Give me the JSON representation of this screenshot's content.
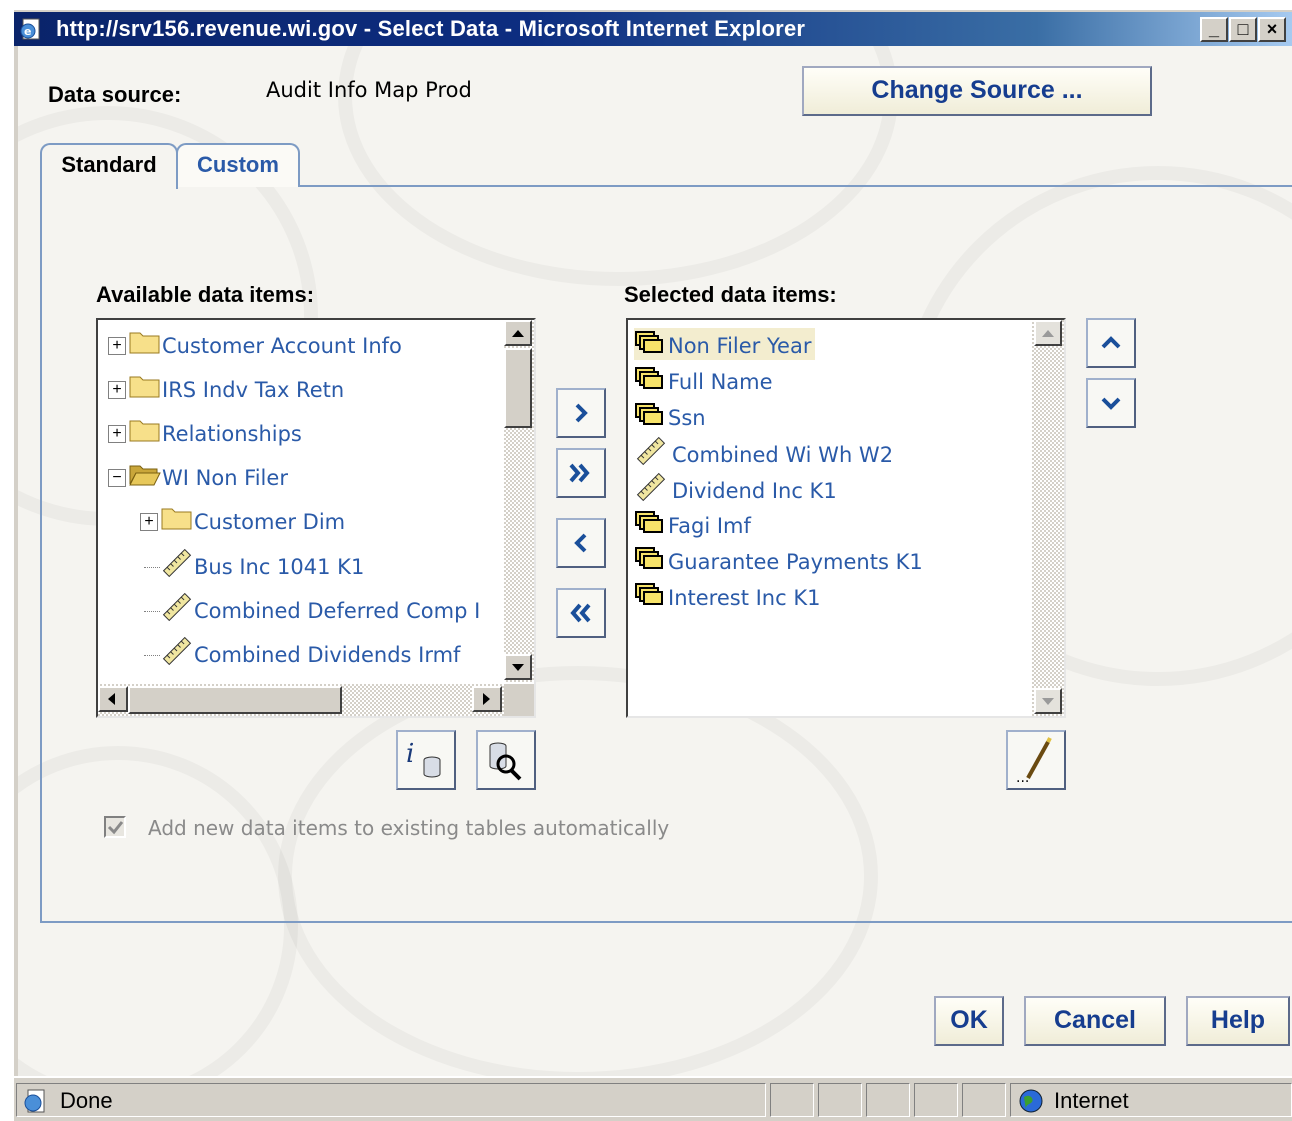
{
  "window": {
    "title": "http://srv156.revenue.wi.gov - Select Data - Microsoft Internet Explorer",
    "minimize": "_",
    "maximize": "□",
    "close": "×"
  },
  "header": {
    "data_source_label": "Data source:",
    "data_source_value": "Audit Info Map Prod",
    "change_source_button": "Change Source ..."
  },
  "tabs": [
    {
      "label": "Standard",
      "active": true
    },
    {
      "label": "Custom",
      "active": false
    }
  ],
  "available": {
    "title": "Available data items:",
    "items": [
      {
        "label": "Customer Account Info",
        "icon": "folder-icon",
        "expander": "+",
        "level": 0
      },
      {
        "label": "IRS Indv Tax Retn",
        "icon": "folder-icon",
        "expander": "+",
        "level": 0
      },
      {
        "label": "Relationships",
        "icon": "folder-icon",
        "expander": "+",
        "level": 0
      },
      {
        "label": "WI Non Filer",
        "icon": "folder-open-icon",
        "expander": "−",
        "level": 0
      },
      {
        "label": "Customer Dim",
        "icon": "folder-icon",
        "expander": "+",
        "level": 1
      },
      {
        "label": "Bus Inc 1041 K1",
        "icon": "measure-icon",
        "expander": "",
        "level": 1
      },
      {
        "label": "Combined Deferred Comp I",
        "icon": "measure-icon",
        "expander": "",
        "level": 1
      },
      {
        "label": "Combined Dividends Irmf",
        "icon": "measure-icon",
        "expander": "",
        "level": 1
      }
    ]
  },
  "selected": {
    "title": "Selected data items:",
    "items": [
      {
        "label": "Non Filer Year",
        "icon": "category-icon",
        "selected": true
      },
      {
        "label": "Full Name",
        "icon": "category-icon",
        "selected": false
      },
      {
        "label": "Ssn",
        "icon": "category-icon",
        "selected": false
      },
      {
        "label": "Combined Wi Wh W2",
        "icon": "measure-icon",
        "selected": false
      },
      {
        "label": "Dividend Inc K1",
        "icon": "measure-icon",
        "selected": false
      },
      {
        "label": "Fagi Imf",
        "icon": "category-icon",
        "selected": false
      },
      {
        "label": "Guarantee Payments K1",
        "icon": "category-icon",
        "selected": false
      },
      {
        "label": "Interest Inc K1",
        "icon": "category-icon",
        "selected": false
      }
    ]
  },
  "checkbox": {
    "label": "Add new data items to existing tables automatically",
    "checked": true
  },
  "footer": {
    "ok": "OK",
    "cancel": "Cancel",
    "help": "Help"
  },
  "status": {
    "text": "Done",
    "zone": "Internet"
  },
  "colors": {
    "accent": "#163d8f",
    "item_text": "#2a5aa8",
    "selection": "#f3edcf",
    "titlebar": "#0a246a"
  }
}
